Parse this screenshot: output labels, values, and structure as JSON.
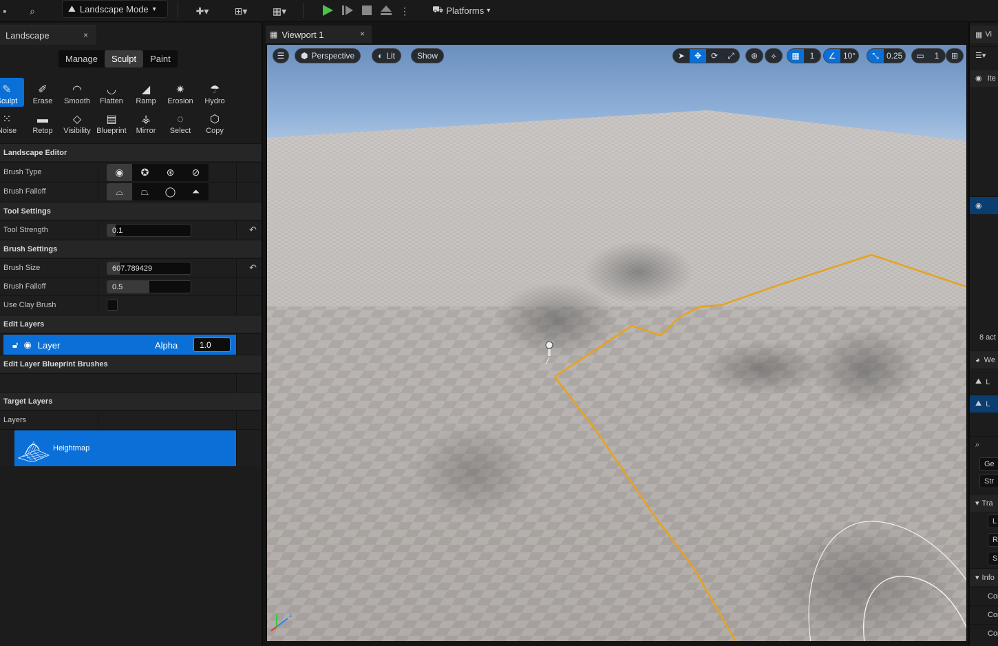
{
  "toolbar": {
    "mode_label": "Landscape Mode",
    "platforms_label": "Platforms"
  },
  "left_panel": {
    "tab_title": "Landscape",
    "close_glyph": "×",
    "mode_tabs": [
      "Manage",
      "Sculpt",
      "Paint"
    ],
    "active_mode": "Sculpt",
    "tools_row1": [
      {
        "label": "Sculpt",
        "icon": "sculpt-brush-icon",
        "glyph": "✎",
        "active": true
      },
      {
        "label": "Erase",
        "icon": "erase-icon",
        "glyph": "✐"
      },
      {
        "label": "Smooth",
        "icon": "smooth-icon",
        "glyph": "◠"
      },
      {
        "label": "Flatten",
        "icon": "flatten-icon",
        "glyph": "◡"
      },
      {
        "label": "Ramp",
        "icon": "ramp-icon",
        "glyph": "◢"
      },
      {
        "label": "Erosion",
        "icon": "erosion-icon",
        "glyph": "✷"
      },
      {
        "label": "Hydro",
        "icon": "hydro-icon",
        "glyph": "☂"
      }
    ],
    "tools_row2": [
      {
        "label": "Noise",
        "icon": "noise-icon",
        "glyph": "⁙"
      },
      {
        "label": "Retop",
        "icon": "retop-icon",
        "glyph": "▬"
      },
      {
        "label": "Visibility",
        "icon": "visibility-icon",
        "glyph": "◇"
      },
      {
        "label": "Blueprint",
        "icon": "blueprint-icon",
        "glyph": "▤"
      },
      {
        "label": "Mirror",
        "icon": "mirror-icon",
        "glyph": "⚶"
      },
      {
        "label": "Select",
        "icon": "select-icon",
        "glyph": "◌"
      },
      {
        "label": "Copy",
        "icon": "copy-icon",
        "glyph": "⬡"
      }
    ],
    "sections": {
      "landscape_editor": "Landscape Editor",
      "tool_settings": "Tool Settings",
      "brush_settings": "Brush Settings",
      "edit_layers": "Edit Layers",
      "edit_layer_blueprint_brushes": "Edit Layer Blueprint Brushes",
      "target_layers": "Target Layers"
    },
    "brush_type_label": "Brush Type",
    "brush_falloff_label": "Brush Falloff",
    "tool_strength_label": "Tool Strength",
    "tool_strength_value": "0.1",
    "tool_strength_fill": 0.1,
    "brush_size_label": "Brush Size",
    "brush_size_value": "607.789429",
    "brush_size_fill": 0.15,
    "brush_falloff2_label": "Brush Falloff",
    "brush_falloff2_value": "0.5",
    "brush_falloff2_fill": 0.5,
    "use_clay_brush_label": "Use Clay Brush",
    "layer_name": "Layer",
    "alpha_label": "Alpha",
    "alpha_value": "1.0",
    "layers_label": "Layers",
    "heightmap_label": "Heightmap"
  },
  "viewport": {
    "tab_title": "Viewport 1",
    "close_glyph": "×",
    "perspective_label": "Perspective",
    "lit_label": "Lit",
    "show_label": "Show",
    "grid_snap_value": "1",
    "rotation_snap_value": "10°",
    "scale_snap_value": "0.25",
    "camera_speed_value": "1"
  },
  "right_panel": {
    "tab_partial": "Vi",
    "item_col": "Ite",
    "actor_count": "8 act",
    "rows": [
      "We",
      "L",
      "L",
      "Ge",
      "Str",
      "Tra",
      "L",
      "R",
      "S",
      "Info",
      "Cor",
      "Cor",
      "Cor"
    ]
  }
}
